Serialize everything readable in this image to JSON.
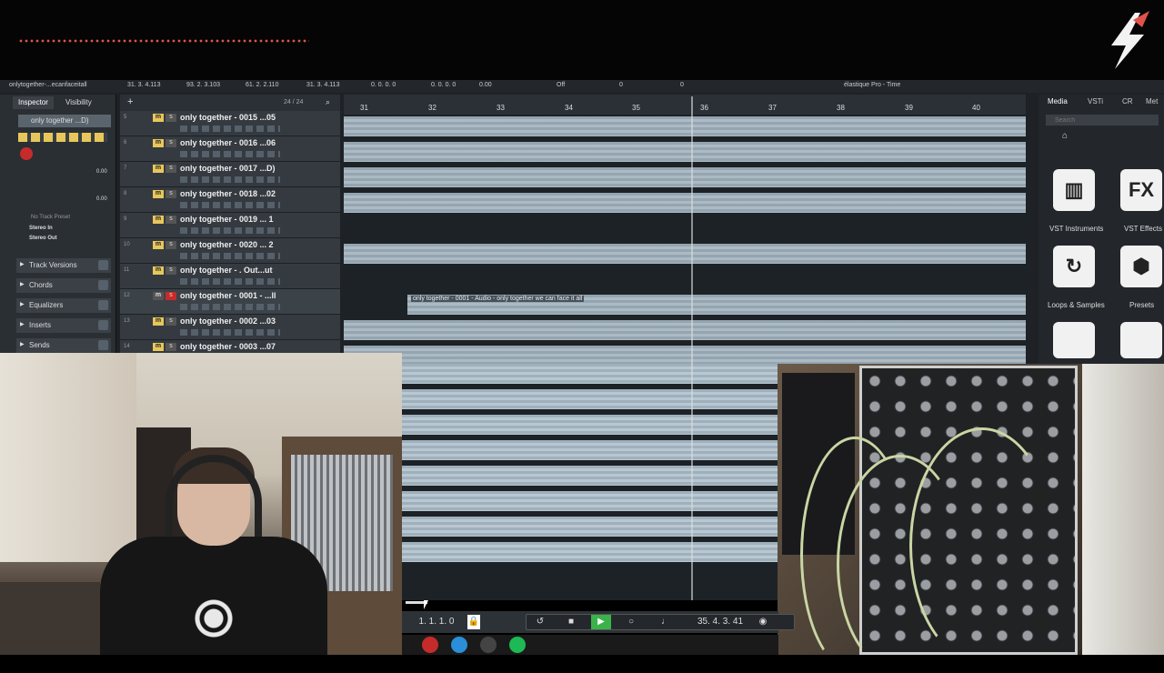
{
  "info_bar": {
    "project": "onlytogether-...ecanfaceitall",
    "start": "31. 3. 4.113",
    "end": "93. 2. 3.103",
    "length": "61. 2. 2.110",
    "offset": "31. 3. 4.113",
    "sync": "0. 0. 0. 0",
    "mute": "0. 0. 0. 0",
    "volume": "0.00",
    "lock": "Off",
    "transpose": "0",
    "fine_tune": "0",
    "algo": "élastique Pro - Time"
  },
  "inspector": {
    "tab_inspector": "Inspector",
    "tab_visibility": "Visibility",
    "track_name": "only together ...D)",
    "volume_val": "0.00",
    "pan_val": "0.00",
    "preset": "No Track Preset",
    "in": "Stereo In",
    "out": "Stereo Out",
    "sections": [
      "Track Versions",
      "Chords",
      "Equalizers",
      "Inserts",
      "Sends"
    ]
  },
  "tracklist": {
    "count": "24 / 24",
    "tracks": [
      {
        "num": "5",
        "name": "only together - 0015 ...05"
      },
      {
        "num": "6",
        "name": "only together - 0016 ...06"
      },
      {
        "num": "7",
        "name": "only together - 0017 ...D)"
      },
      {
        "num": "8",
        "name": "only together - 0018 ...02"
      },
      {
        "num": "9",
        "name": "only together - 0019 ... 1"
      },
      {
        "num": "10",
        "name": "only together - 0020 ... 2"
      },
      {
        "num": "11",
        "name": "only together - . Out...ut"
      },
      {
        "num": "12",
        "name": "only together - 0001 - ...ll"
      },
      {
        "num": "13",
        "name": "only together - 0002 ...03"
      },
      {
        "num": "14",
        "name": "only together - 0003 ...07"
      }
    ]
  },
  "ruler": {
    "bars": [
      "31",
      "32",
      "33",
      "34",
      "35",
      "36",
      "37",
      "38",
      "39",
      "40"
    ]
  },
  "event_label": "only together - 0001 - Audio - only together we can face it all",
  "media": {
    "tabs": [
      "Media",
      "VSTi",
      "CR",
      "Met"
    ],
    "search_placeholder": "Search",
    "items": [
      {
        "label": "VST Instruments",
        "icon": "piano-icon",
        "glyph": "▥"
      },
      {
        "label": "VST Effects",
        "icon": "fx-icon",
        "glyph": "FX"
      },
      {
        "label": "Loops & Samples",
        "icon": "loop-icon",
        "glyph": "↻"
      },
      {
        "label": "Presets",
        "icon": "presets-icon",
        "glyph": "⬢"
      }
    ]
  },
  "transport": {
    "left_locator": "1. 1. 1.   0",
    "position": "35. 4. 3. 41"
  }
}
